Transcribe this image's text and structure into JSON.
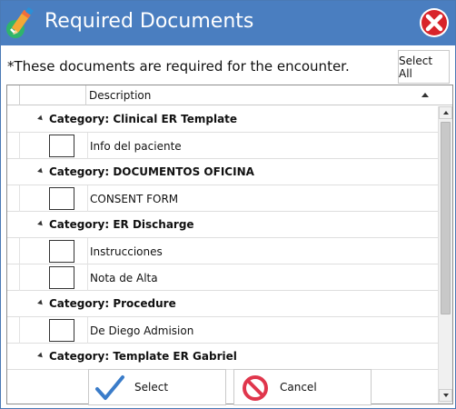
{
  "window": {
    "title": "Required Documents",
    "app_icon": "pencil-check-icon",
    "close_icon": "close-icon",
    "accent_color": "#4a7ec0"
  },
  "note": "*These documents are required for the encounter.",
  "toolbar": {
    "select_all_label": "Select All"
  },
  "grid": {
    "header": {
      "description_label": "Description"
    },
    "groups": [
      {
        "category": "Category: Clinical ER Template",
        "items": [
          "Info del paciente"
        ]
      },
      {
        "category": "Category: DOCUMENTOS OFICINA",
        "items": [
          "CONSENT FORM"
        ]
      },
      {
        "category": "Category: ER Discharge",
        "items": [
          "Instrucciones",
          "Nota de Alta"
        ]
      },
      {
        "category": "Category: Procedure",
        "items": [
          "De Diego Admision"
        ]
      },
      {
        "category": "Category: Template ER Gabriel",
        "items": []
      }
    ]
  },
  "buttons": {
    "select_label": "Select",
    "cancel_label": "Cancel"
  }
}
